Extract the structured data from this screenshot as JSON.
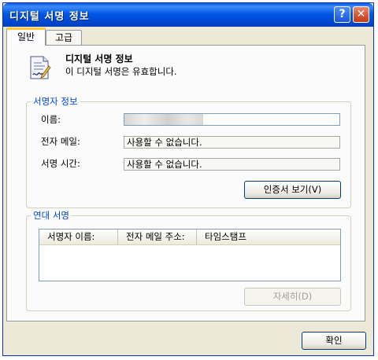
{
  "window": {
    "title": "디지털 서명 정보"
  },
  "title_buttons": {
    "help": "?",
    "close": "✕"
  },
  "tabs": [
    {
      "label": "일반",
      "active": true
    },
    {
      "label": "고급",
      "active": false
    }
  ],
  "header": {
    "title": "디지털 서명 정보",
    "subtitle": "이 디지털 서명은 유효합니다.",
    "icon": "signed-document-icon"
  },
  "signer_info": {
    "legend": "서명자 정보",
    "name_label": "이름:",
    "name_value": "",
    "email_label": "전자 메일:",
    "email_value": "사용할 수 없습니다.",
    "time_label": "서명 시간:",
    "time_value": "사용할 수 없습니다.",
    "view_cert_button": "인증서 보기(V)"
  },
  "countersignatures": {
    "legend": "연대 서명",
    "columns": [
      "서명자 이름:",
      "전자 메일 주소:",
      "타임스탬프"
    ],
    "rows": [],
    "details_button": "자세히(D)"
  },
  "footer": {
    "ok_button": "확인"
  },
  "colors": {
    "title_bar": "#0058e6",
    "legend_text": "#0046d5",
    "dialog_bg": "#ece9d8",
    "active_tab_accent": "#ffc83c"
  }
}
